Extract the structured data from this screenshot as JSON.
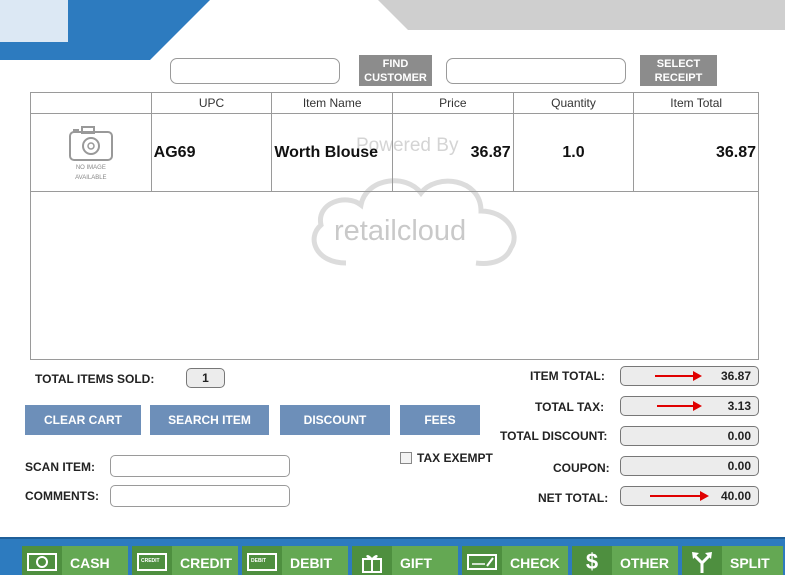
{
  "header": {
    "find_customer_label": "FIND\nCUSTOMER",
    "select_receipt_label": "SELECT\nRECEIPT"
  },
  "table": {
    "columns": [
      "",
      "UPC",
      "Item Name",
      "Price",
      "Quantity",
      "Item Total"
    ],
    "rows": [
      {
        "image_text": "NO IMAGE\nAVAILABLE",
        "upc": "AG69",
        "item_name": "Worth Blouse",
        "price": "36.87",
        "quantity": "1.0",
        "item_total": "36.87"
      }
    ],
    "watermark_powered": "Powered By",
    "watermark_brand": "retailcloud"
  },
  "summary": {
    "total_items_sold_label": "TOTAL ITEMS SOLD:",
    "total_items_sold": "1",
    "item_total_label": "ITEM TOTAL:",
    "item_total": "36.87",
    "total_tax_label": "TOTAL TAX:",
    "total_tax": "3.13",
    "total_discount_label": "TOTAL DISCOUNT:",
    "total_discount": "0.00",
    "coupon_label": "COUPON:",
    "coupon": "0.00",
    "net_total_label": "NET TOTAL:",
    "net_total": "40.00"
  },
  "actions": {
    "clear_cart": "CLEAR CART",
    "search_item": "SEARCH ITEM",
    "discount": "DISCOUNT",
    "fees": "FEES",
    "tax_exempt": "TAX EXEMPT"
  },
  "inputs": {
    "scan_item_label": "SCAN ITEM:",
    "comments_label": "COMMENTS:"
  },
  "payments": [
    {
      "label": "CASH",
      "icon": "cash-icon"
    },
    {
      "label": "CREDIT",
      "icon": "credit-card-icon",
      "icon_text": "CREDIT"
    },
    {
      "label": "DEBIT",
      "icon": "debit-card-icon",
      "icon_text": "DEBIT"
    },
    {
      "label": "GIFT",
      "icon": "gift-icon"
    },
    {
      "label": "CHECK",
      "icon": "check-icon"
    },
    {
      "label": "OTHER",
      "icon": "dollar-icon",
      "icon_text": "$"
    },
    {
      "label": "SPLIT",
      "icon": "split-arrows-icon"
    }
  ],
  "colors": {
    "header_blue": "#2d7bbf",
    "header_gray": "#cfcfcf",
    "action_blue": "#6d8fb9",
    "payment_green": "#64a853",
    "arrow_red": "#e00000"
  }
}
